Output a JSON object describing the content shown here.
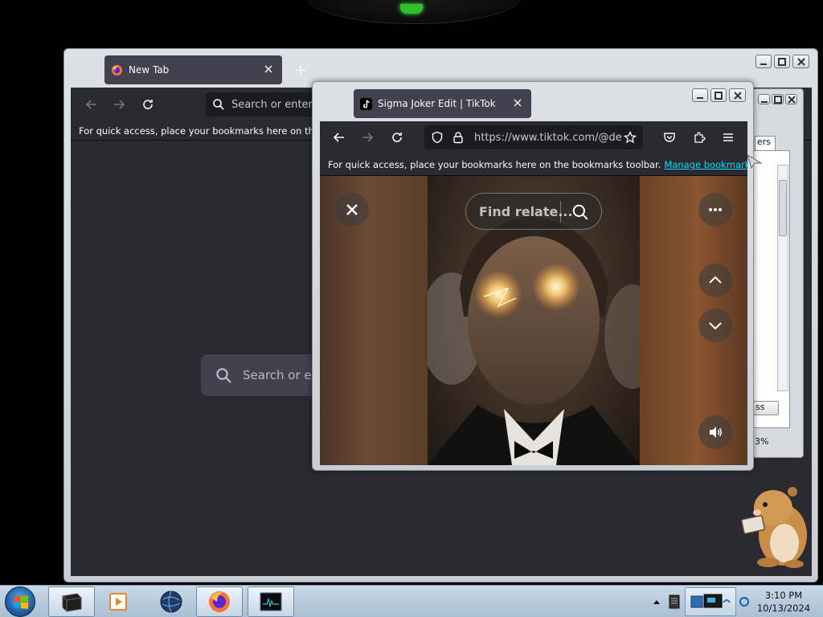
{
  "back_window": {
    "tab": {
      "title": "New Tab"
    },
    "search_placeholder": "Search or enter a",
    "bookmarks_bar_text": "For quick access, place your bookmarks here on the bo",
    "new_tab_search_placeholder": "Search or ent"
  },
  "front_window": {
    "tab": {
      "title": "Sigma Joker Edit | TikTok"
    },
    "url": "https://www.tiktok.com/@de",
    "bookmarks_bar_text": "For quick access, place your bookmarks here on the bookmarks toolbar.",
    "manage_bookmarks_link": "Manage bookmarks…"
  },
  "tiktok": {
    "find_related_placeholder": "Find relate..."
  },
  "background_app": {
    "tab_fragment": "ers",
    "button_fragment": "ss",
    "percent_fragment": "3%"
  },
  "taskbar": {
    "time": "3:10 PM",
    "date": "10/13/2024",
    "items": [
      "terminal",
      "media-player",
      "globe-app",
      "firefox",
      "task-manager"
    ]
  },
  "colors": {
    "firefox_dark": "#1c1b22",
    "firefox_toolbar": "#2b2a33",
    "firefox_tab": "#42414d",
    "link": "#00ddff",
    "taskbar": "#b8cbdd"
  }
}
